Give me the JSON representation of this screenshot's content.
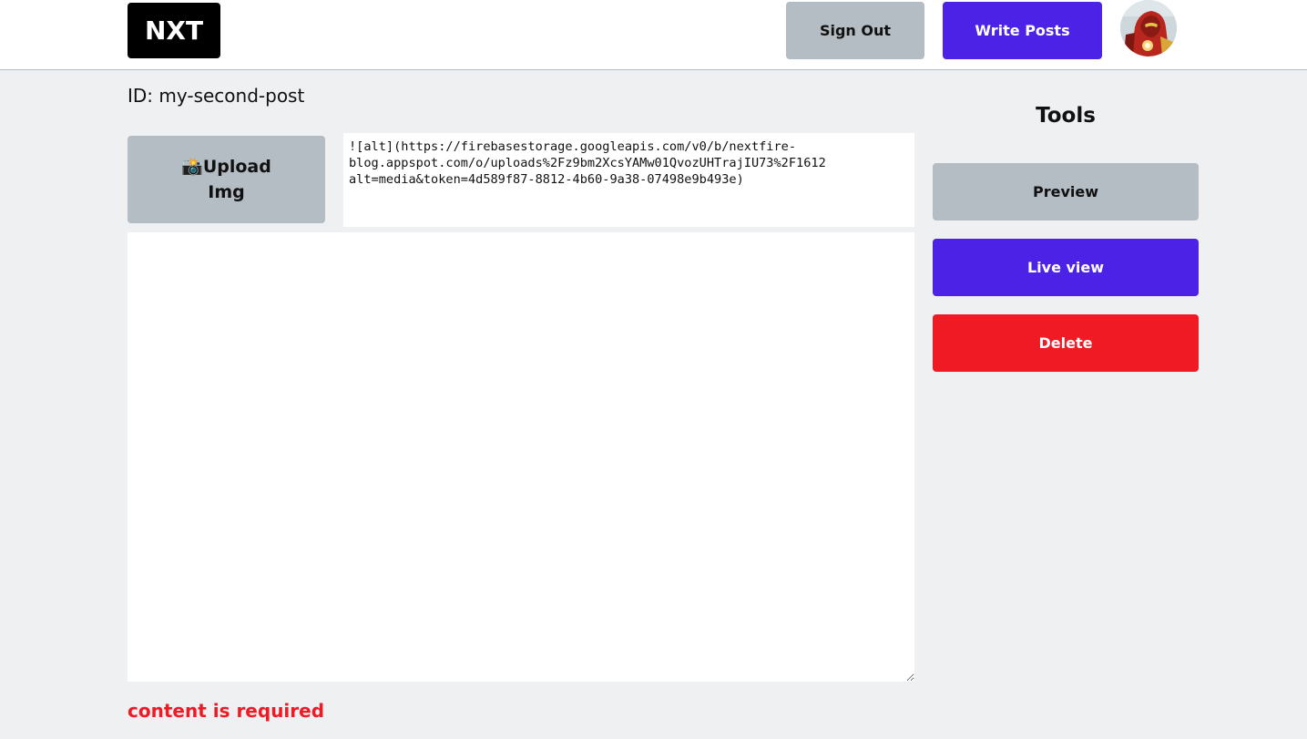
{
  "navbar": {
    "logo_text": "NXT",
    "sign_out_label": "Sign Out",
    "write_posts_label": "Write Posts",
    "avatar_icon": "user-avatar-icon"
  },
  "post": {
    "id_label": "ID: my-second-post"
  },
  "upload": {
    "icon": "camera-flash-icon",
    "emoji": "📸",
    "label_line1": "Upload",
    "label_line2": "Img"
  },
  "image_markdown": {
    "line1": "![alt](https://firebasestorage.googleapis.com/v0/b/nextfire-",
    "line2": "blog.appspot.com/o/uploads%2Fz9bm2XcsYAMw01QvozUHTrajIU73%2F1612",
    "line3": "alt=media&token=4d589f87-8812-4b60-9a38-07498e9b493e)"
  },
  "editor": {
    "content": ""
  },
  "validation": {
    "error": "content is required"
  },
  "tools": {
    "title": "Tools",
    "preview_label": "Preview",
    "live_view_label": "Live view",
    "delete_label": "Delete"
  },
  "colors": {
    "primary": "#4b22e6",
    "danger": "#f01a24",
    "gray": "#b5bdc4",
    "background": "#eef0f1"
  }
}
